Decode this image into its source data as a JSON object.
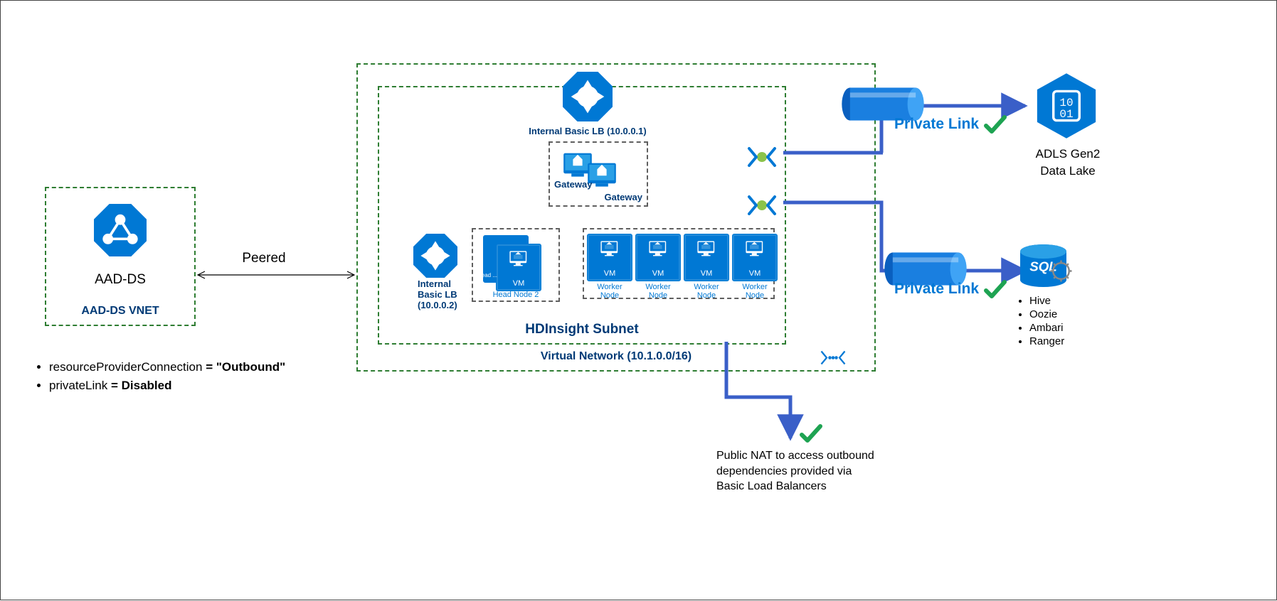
{
  "aad": {
    "title": "AAD-DS",
    "vnet": "AAD-DS VNET"
  },
  "peer": {
    "label": "Peered"
  },
  "config": {
    "rpcKey": "resourceProviderConnection",
    "rpcVal": "\"Outbound\"",
    "plKey": "privateLink",
    "plVal": "Disabled"
  },
  "vnet": {
    "title": "Virtual Network (10.1.0.0/16)"
  },
  "subnet": {
    "title": "HDInsight Subnet"
  },
  "lb1": {
    "label": "Internal Basic LB (10.0.0.1)"
  },
  "lb2": {
    "line1": "Internal",
    "line2": "Basic LB",
    "line3": "(10.0.0.2)"
  },
  "gw": {
    "a": "Gateway",
    "b": "Gateway"
  },
  "head": {
    "n1": "Head ...",
    "n2": "Head Node 2"
  },
  "workers": {
    "w": "Worker Node"
  },
  "pl": {
    "label": "Private Link"
  },
  "adls": {
    "line1": "ADLS Gen2",
    "line2": "Data Lake"
  },
  "sql": {
    "title": "SQL",
    "s1": "Hive",
    "s2": "Oozie",
    "s3": "Ambari",
    "s4": "Ranger"
  },
  "nat": {
    "text": "Public NAT to access outbound dependencies provided via Basic Load Balancers"
  }
}
